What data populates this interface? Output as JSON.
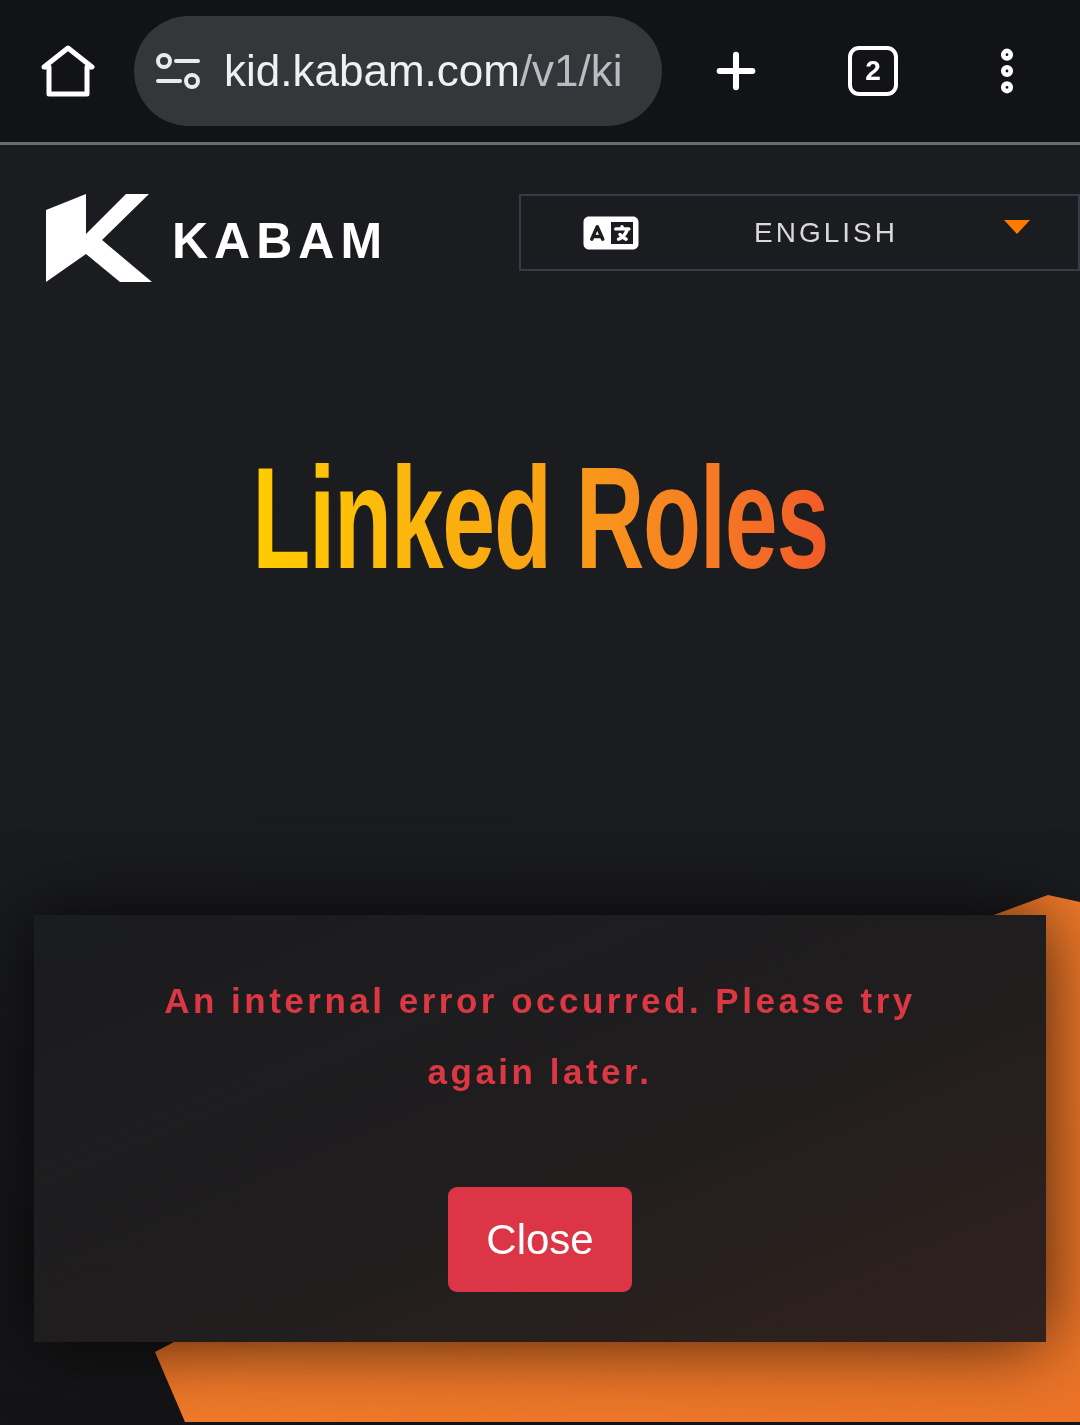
{
  "browser": {
    "url_host": "kid.kabam.com",
    "url_path": "/v1/ki",
    "tab_count": "2"
  },
  "header": {
    "logo_text": "KABAM",
    "language": {
      "label": "ENGLISH"
    }
  },
  "page": {
    "title": "Linked Roles"
  },
  "dialog": {
    "message": "An internal error occurred. Please try again later.",
    "buttons": [
      {
        "label": "Close"
      }
    ]
  }
}
